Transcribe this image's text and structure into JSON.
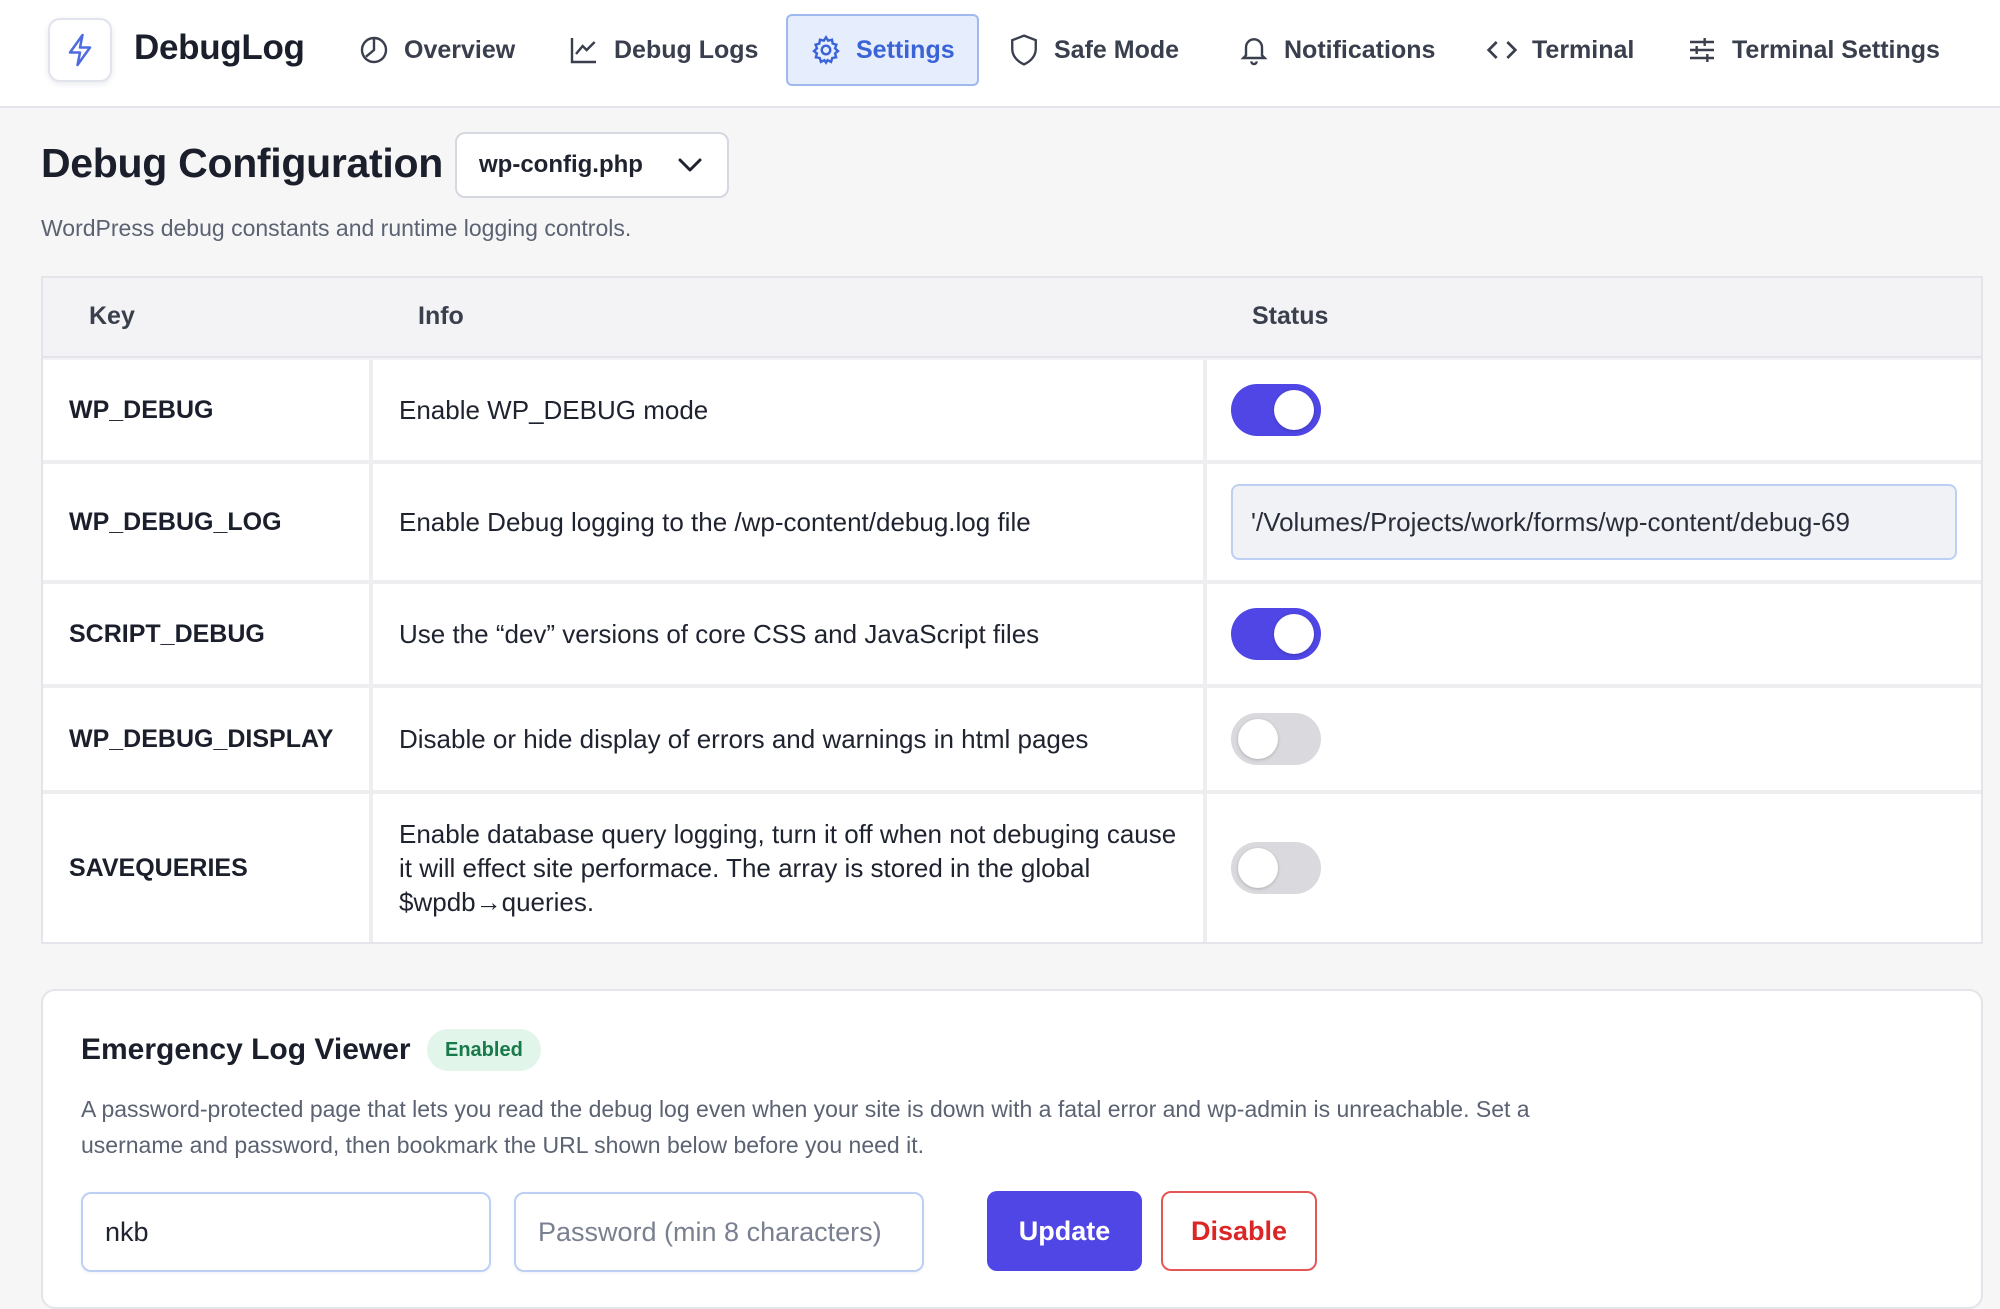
{
  "app": {
    "name": "DebugLog",
    "logo_icon": "bolt-icon"
  },
  "nav": [
    {
      "label": "Overview",
      "icon": "clock-chart-icon",
      "active": false
    },
    {
      "label": "Debug Logs",
      "icon": "line-chart-icon",
      "active": false
    },
    {
      "label": "Settings",
      "icon": "gear-icon",
      "active": true
    },
    {
      "label": "Safe Mode",
      "icon": "shield-icon",
      "active": false
    },
    {
      "label": "Notifications",
      "icon": "bell-icon",
      "active": false
    },
    {
      "label": "Terminal",
      "icon": "code-icon",
      "active": false
    },
    {
      "label": "Terminal Settings",
      "icon": "sliders-icon",
      "active": false
    }
  ],
  "page": {
    "title": "Debug Configuration",
    "file_select": "wp-config.php",
    "subtitle": "WordPress debug constants and runtime logging controls."
  },
  "table": {
    "headers": {
      "key": "Key",
      "info": "Info",
      "status": "Status"
    },
    "rows": [
      {
        "key": "WP_DEBUG",
        "info": "Enable WP_DEBUG mode",
        "status_type": "toggle",
        "enabled": true
      },
      {
        "key": "WP_DEBUG_LOG",
        "info": "Enable Debug logging to the /wp-content/debug.log file",
        "status_type": "input",
        "value": "'/Volumes/Projects/work/forms/wp-content/debug-69"
      },
      {
        "key": "SCRIPT_DEBUG",
        "info": "Use the “dev” versions of core CSS and JavaScript files",
        "status_type": "toggle",
        "enabled": true
      },
      {
        "key": "WP_DEBUG_DISPLAY",
        "info": "Disable or hide display of errors and warnings in html pages",
        "status_type": "toggle",
        "enabled": false
      },
      {
        "key": "SAVEQUERIES",
        "info": "Enable database query logging, turn it off when not debuging cause it will effect site performace. The array is stored in the global $wpdb→queries.",
        "status_type": "toggle",
        "enabled": false
      }
    ]
  },
  "emergency": {
    "title": "Emergency Log Viewer",
    "badge": "Enabled",
    "description": "A password-protected page that lets you read the debug log even when your site is down with a fatal error and wp-admin is unreachable. Set a username and password, then bookmark the URL shown below before you need it.",
    "username_value": "nkb",
    "password_placeholder": "Password (min 8 characters)",
    "update_label": "Update",
    "disable_label": "Disable"
  },
  "colors": {
    "accent": "#4f46e5",
    "active_nav": "#3a63d8",
    "danger": "#dc2626",
    "badge_green": "#18794a"
  }
}
